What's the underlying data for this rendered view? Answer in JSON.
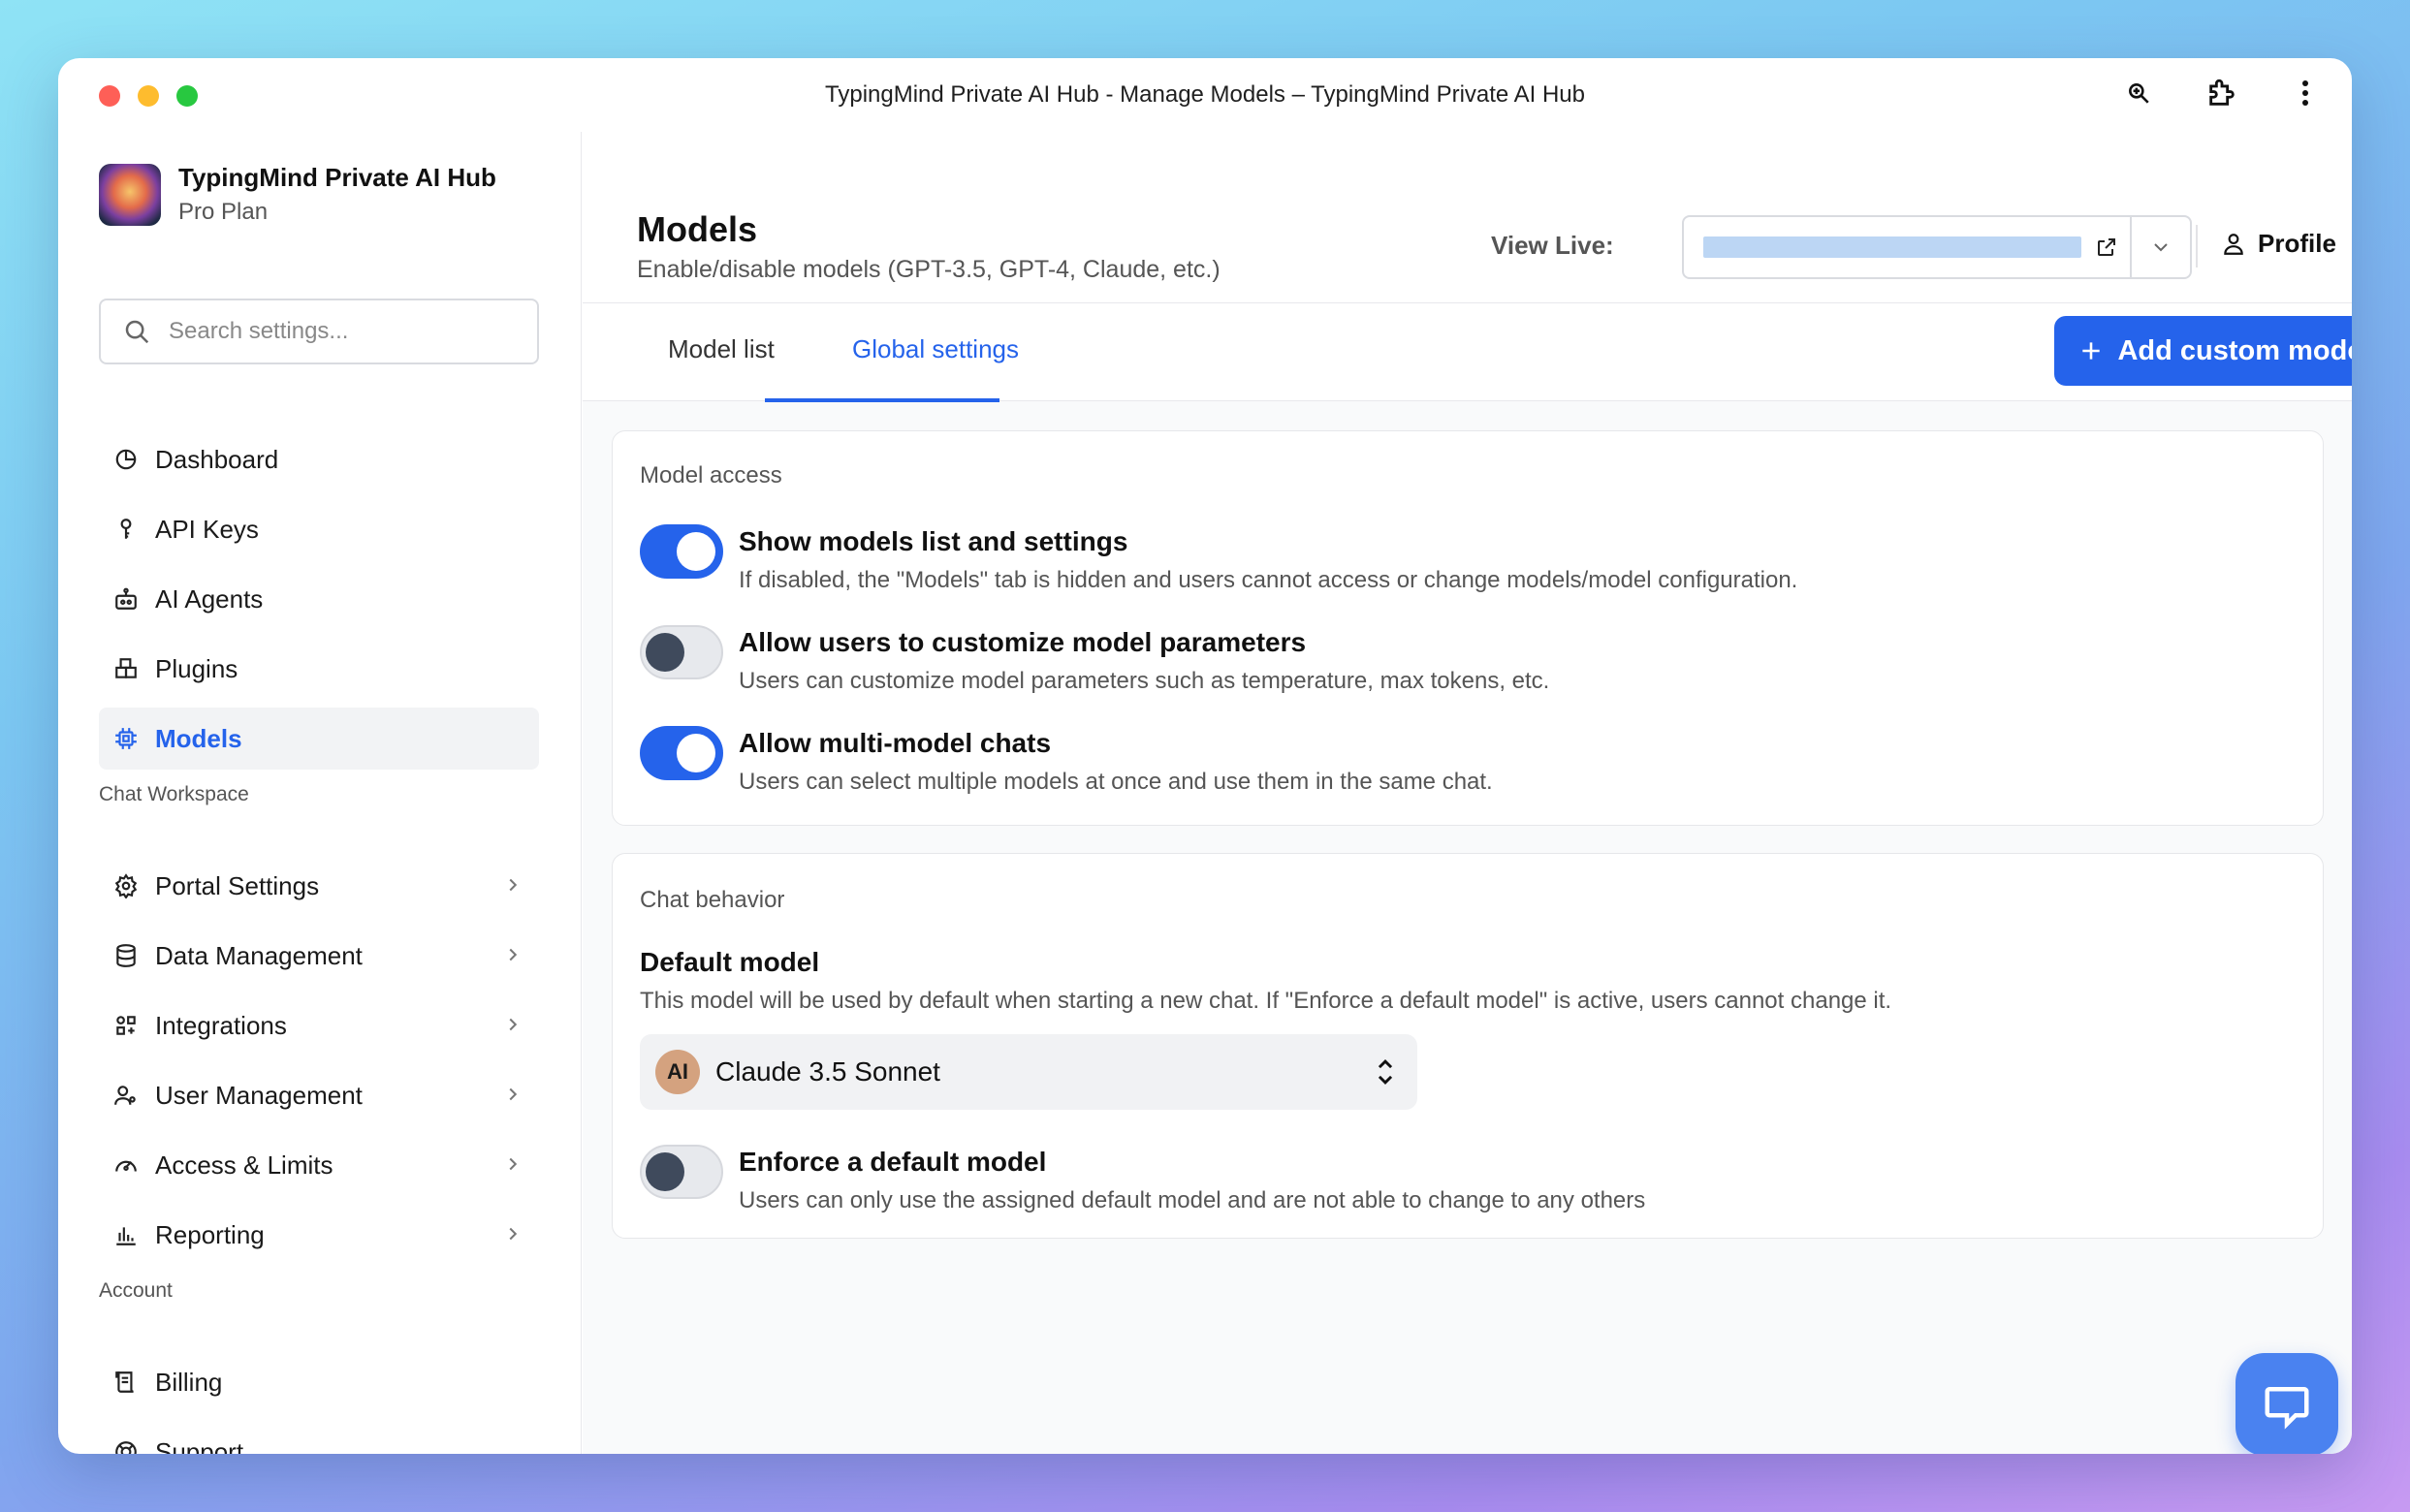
{
  "window": {
    "title": "TypingMind Private AI Hub - Manage Models – TypingMind Private AI Hub"
  },
  "brand": {
    "name": "TypingMind Private AI Hub",
    "plan": "Pro Plan"
  },
  "search": {
    "placeholder": "Search settings..."
  },
  "sidebar": {
    "main_items": [
      {
        "label": "Dashboard",
        "icon": "pie-chart-icon"
      },
      {
        "label": "API Keys",
        "icon": "key-icon"
      },
      {
        "label": "AI Agents",
        "icon": "agents-icon"
      },
      {
        "label": "Plugins",
        "icon": "plugins-icon"
      },
      {
        "label": "Models",
        "icon": "chip-icon",
        "active": true
      }
    ],
    "workspace_label": "Chat Workspace",
    "workspace_items": [
      {
        "label": "Portal Settings",
        "icon": "gear-icon"
      },
      {
        "label": "Data Management",
        "icon": "database-icon"
      },
      {
        "label": "Integrations",
        "icon": "integrations-icon"
      },
      {
        "label": "User Management",
        "icon": "users-icon"
      },
      {
        "label": "Access & Limits",
        "icon": "gauge-icon"
      },
      {
        "label": "Reporting",
        "icon": "bar-chart-icon"
      }
    ],
    "account_label": "Account",
    "account_items": [
      {
        "label": "Billing",
        "icon": "receipt-icon"
      },
      {
        "label": "Support",
        "icon": "lifebuoy-icon"
      }
    ]
  },
  "header": {
    "title": "Models",
    "subtitle": "Enable/disable models (GPT-3.5, GPT-4, Claude, etc.)",
    "view_live_label": "View Live:",
    "profile_label": "Profile"
  },
  "tabs": [
    {
      "label": "Model list",
      "active": false
    },
    {
      "label": "Global settings",
      "active": true
    }
  ],
  "add_button": {
    "label": "Add custom model"
  },
  "model_access": {
    "title": "Model access",
    "settings": [
      {
        "title": "Show models list and settings",
        "desc": "If disabled, the \"Models\" tab is hidden and users cannot access or change models/model configuration.",
        "enabled": true
      },
      {
        "title": "Allow users to customize model parameters",
        "desc": "Users can customize model parameters such as temperature, max tokens, etc.",
        "enabled": false
      },
      {
        "title": "Allow multi-model chats",
        "desc": "Users can select multiple models at once and use them in the same chat.",
        "enabled": true
      }
    ]
  },
  "chat_behavior": {
    "title": "Chat behavior",
    "default_model_title": "Default model",
    "default_model_desc": "This model will be used by default when starting a new chat. If \"Enforce a default model\" is active, users cannot change it.",
    "selected_model": "Claude 3.5 Sonnet",
    "model_logo": "AI",
    "enforce_title": "Enforce a default model",
    "enforce_desc": "Users can only use the assigned default model and are not able to change to any others",
    "enforce_enabled": false
  },
  "colors": {
    "accent": "#2563eb",
    "toggle_off_knob": "#3f4a5c",
    "claude_badge": "#d4a27f"
  }
}
